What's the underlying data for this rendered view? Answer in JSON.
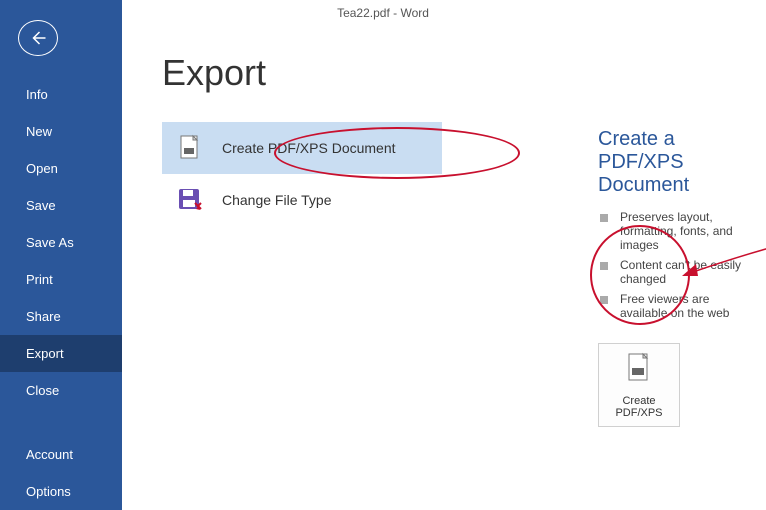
{
  "titlebar": "Tea22.pdf - Word",
  "sidebar": {
    "items": [
      {
        "label": "Info"
      },
      {
        "label": "New"
      },
      {
        "label": "Open"
      },
      {
        "label": "Save"
      },
      {
        "label": "Save As"
      },
      {
        "label": "Print"
      },
      {
        "label": "Share"
      },
      {
        "label": "Export"
      },
      {
        "label": "Close"
      }
    ],
    "footer": [
      {
        "label": "Account"
      },
      {
        "label": "Options"
      }
    ],
    "active_index": 7
  },
  "main": {
    "heading": "Export",
    "options": [
      {
        "label": "Create PDF/XPS Document",
        "icon": "pdf-page-icon",
        "selected": true
      },
      {
        "label": "Change File Type",
        "icon": "save-as-icon",
        "selected": false
      }
    ],
    "detail": {
      "title": "Create a PDF/XPS Document",
      "bullets": [
        "Preserves layout, formatting, fonts, and images",
        "Content can't be easily changed",
        "Free viewers are available on the web"
      ],
      "button": {
        "line1": "Create",
        "line2": "PDF/XPS"
      }
    }
  }
}
